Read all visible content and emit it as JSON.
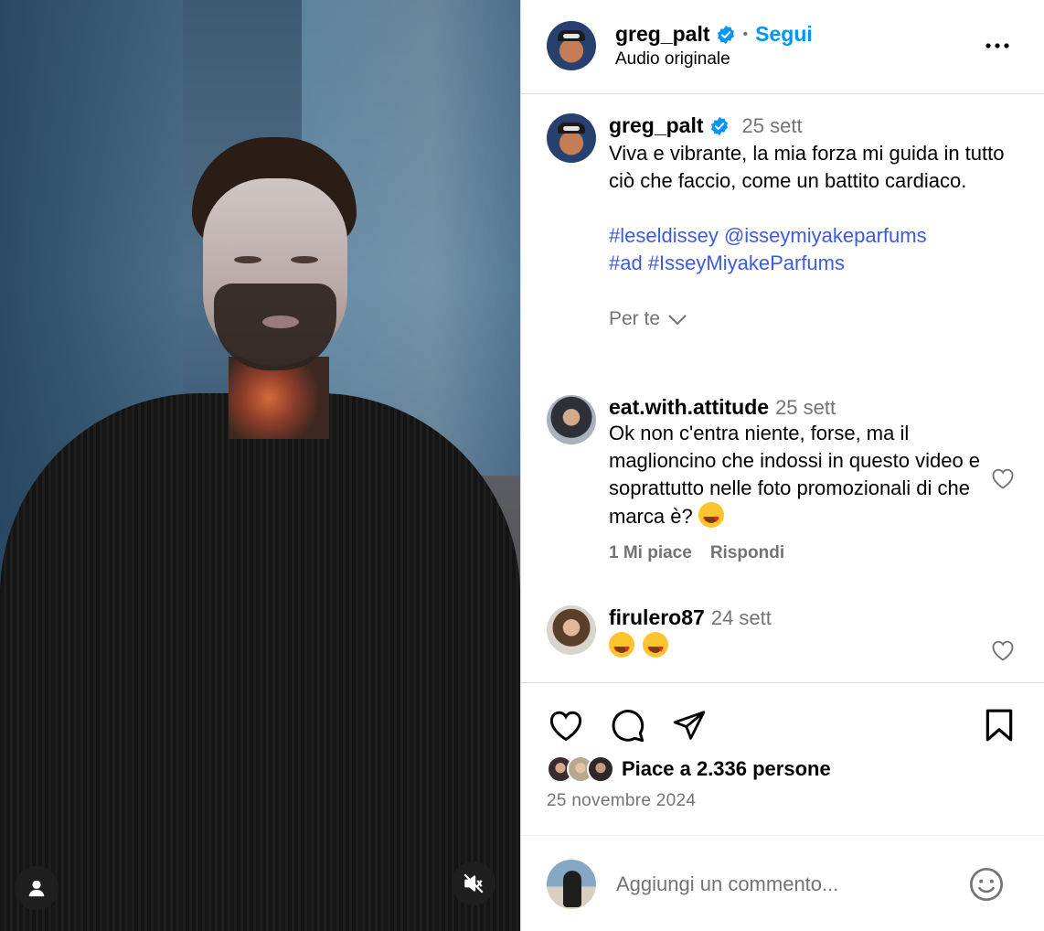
{
  "post": {
    "author": "greg_palt",
    "follow_label": "Segui",
    "audio": "Audio originale",
    "date": "25 sett",
    "caption": "Viva e vibrante, la mia forza mi guida in tutto ciò che faccio, come un battito cardiaco.",
    "tags_line1": "#leseldissey @isseymiyakeparfums",
    "tags_line2": "#ad #IsseyMiyakeParfums",
    "for_you": "Per te"
  },
  "comments": [
    {
      "author": "eat.with.attitude",
      "date": "25 sett",
      "text": "Ok non c'entra niente, forse, ma il maglioncino che indossi in questo video e soprattutto nelle foto promozionali di che marca è?",
      "likes": "1 Mi piace",
      "reply": "Rispondi"
    },
    {
      "author": "firulero87",
      "date": "24 sett",
      "text": ""
    }
  ],
  "footer": {
    "likes_text": "Piace a 2.336 persone",
    "post_date": "25 novembre 2024",
    "comment_placeholder": "Aggiungi un commento..."
  },
  "colors": {
    "link": "#3e5bd8",
    "follow": "#0095f6",
    "verified": "#0095f6",
    "muted": "#737373"
  },
  "icons": [
    "more-icon",
    "verified-icon",
    "chevron-down-icon",
    "heart-icon",
    "comment-icon",
    "share-icon",
    "bookmark-icon",
    "smile-icon",
    "user-icon",
    "mute-icon",
    "heart-eyes-emoji"
  ]
}
